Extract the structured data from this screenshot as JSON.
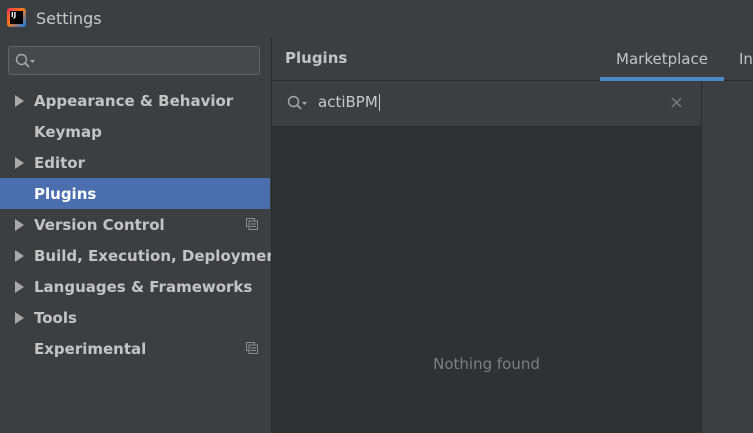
{
  "window": {
    "title": "Settings",
    "app_icon_text": "IJ"
  },
  "sidebar": {
    "search_placeholder": "",
    "items": [
      {
        "label": "Appearance & Behavior",
        "expandable": true,
        "selected": false,
        "has_project_icon": false
      },
      {
        "label": "Keymap",
        "expandable": false,
        "selected": false,
        "has_project_icon": false
      },
      {
        "label": "Editor",
        "expandable": true,
        "selected": false,
        "has_project_icon": false
      },
      {
        "label": "Plugins",
        "expandable": false,
        "selected": true,
        "has_project_icon": false
      },
      {
        "label": "Version Control",
        "expandable": true,
        "selected": false,
        "has_project_icon": true
      },
      {
        "label": "Build, Execution, Deployment",
        "expandable": true,
        "selected": false,
        "has_project_icon": false
      },
      {
        "label": "Languages & Frameworks",
        "expandable": true,
        "selected": false,
        "has_project_icon": false
      },
      {
        "label": "Tools",
        "expandable": true,
        "selected": false,
        "has_project_icon": false
      },
      {
        "label": "Experimental",
        "expandable": false,
        "selected": false,
        "has_project_icon": true
      }
    ]
  },
  "main": {
    "title": "Plugins",
    "tabs": [
      {
        "label": "Marketplace",
        "active": true
      },
      {
        "label": "In",
        "active": false
      }
    ],
    "search": {
      "value": "actiBPM"
    },
    "empty_message": "Nothing found"
  },
  "icons": {
    "search": "search-icon",
    "clear": "close-icon",
    "expand": "chevron-right-icon",
    "project_scope": "copy-icon"
  },
  "colors": {
    "background": "#3c3f41",
    "selection": "#4b6eaf",
    "tab_underline": "#4a88c7",
    "results_background": "#2f3133"
  }
}
